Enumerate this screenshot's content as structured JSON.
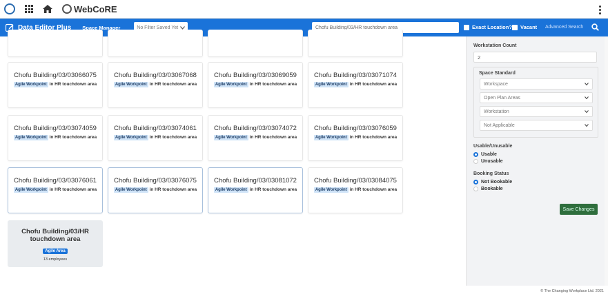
{
  "topbar": {
    "brand": "WebCoRE"
  },
  "bluebar": {
    "app_title": "Data Editor Plus",
    "space_manager": "Space Manager",
    "filter_value": "No Filter Saved Yet",
    "search_value": "Chofu Building/03/HR touchdown area",
    "exact_location": "Exact Location?",
    "vacant": "Vacant",
    "advanced_search": "Advanced Search"
  },
  "cards": [
    {
      "title": "Chofu Building/03/03066075",
      "badge": "Agile Workpoint",
      "location": "in HR touchdown area"
    },
    {
      "title": "Chofu Building/03/03067068",
      "badge": "Agile Workpoint",
      "location": "in HR touchdown area"
    },
    {
      "title": "Chofu Building/03/03069059",
      "badge": "Agile Workpoint",
      "location": "in HR touchdown area"
    },
    {
      "title": "Chofu Building/03/03071074",
      "badge": "Agile Workpoint",
      "location": "in HR touchdown area"
    },
    {
      "title": "Chofu Building/03/03074059",
      "badge": "Agile Workpoint",
      "location": "in HR touchdown area"
    },
    {
      "title": "Chofu Building/03/03074061",
      "badge": "Agile Workpoint",
      "location": "in HR touchdown area"
    },
    {
      "title": "Chofu Building/03/03074072",
      "badge": "Agile Workpoint",
      "location": "in HR touchdown area"
    },
    {
      "title": "Chofu Building/03/03076059",
      "badge": "Agile Workpoint",
      "location": "in HR touchdown area"
    },
    {
      "title": "Chofu Building/03/03076061",
      "badge": "Agile Workpoint",
      "location": "in HR touchdown area"
    },
    {
      "title": "Chofu Building/03/03076075",
      "badge": "Agile Workpoint",
      "location": "in HR touchdown area"
    },
    {
      "title": "Chofu Building/03/03081072",
      "badge": "Agile Workpoint",
      "location": "in HR touchdown area"
    },
    {
      "title": "Chofu Building/03/03084075",
      "badge": "Agile Workpoint",
      "location": "in HR touchdown area"
    }
  ],
  "area_card": {
    "title_line1": "Chofu Building/03/HR",
    "title_line2": "touchdown area",
    "badge": "Agile Area",
    "employees": "13 employees"
  },
  "side": {
    "workstation_count_label": "Workstation Count",
    "workstation_count_value": "2",
    "space_standard_label": "Space Standard",
    "selects": [
      "Workspace",
      "Open Plan Areas",
      "Workstation",
      "Not Applicable"
    ],
    "usable_label": "Usable/Unusable",
    "usable": "Usable",
    "unusable": "Unusable",
    "booking_label": "Booking Status",
    "not_bookable": "Not Bookable",
    "bookable": "Bookable",
    "save": "Save Changes"
  },
  "footer": "© The Changing Workplace Ltd. 2021"
}
